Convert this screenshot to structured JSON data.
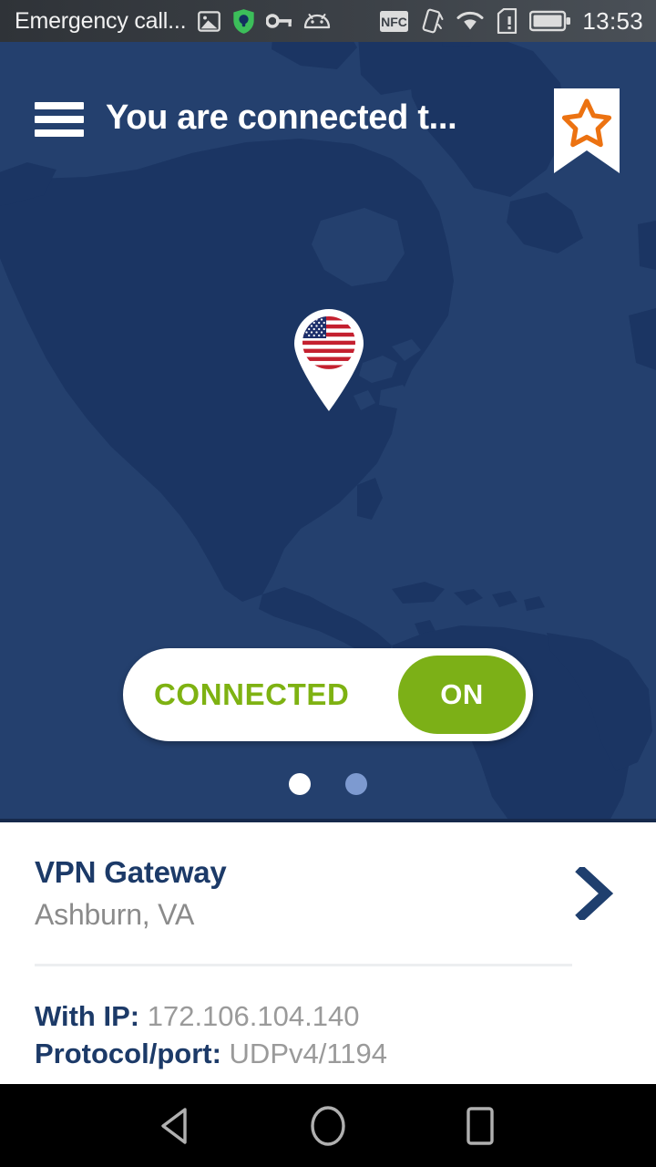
{
  "status_bar": {
    "carrier_text": "Emergency call...",
    "clock": "13:53",
    "left_icons": [
      "screenshot-icon",
      "openvpn-shield-icon",
      "vpn-key-icon",
      "android-robot-icon"
    ],
    "right_icons": [
      "nfc-icon",
      "vibrate-icon",
      "wifi-icon",
      "sim-alert-icon",
      "battery-icon"
    ],
    "background": "#3c4147",
    "text_color": "#f2f2f2"
  },
  "app_bar": {
    "title": "You are connected t...",
    "menu_icon": "hamburger-menu-icon",
    "favorite_icon": "star-ribbon-icon",
    "star_color": "#ec7211",
    "ribbon_color": "#ffffff"
  },
  "map": {
    "ocean_color": "#24406e",
    "land_color": "#1b3563",
    "marker": "us-flag-map-pin",
    "marker_country": "United States"
  },
  "toggle": {
    "label": "CONNECTED",
    "knob_label": "ON",
    "state": "on",
    "green": "#7cb017",
    "track_color": "#ffffff"
  },
  "pager": {
    "total": 2,
    "active_index": 0,
    "active_color": "#ffffff",
    "inactive_color": "#7d9ad0"
  },
  "gateway": {
    "title": "VPN Gateway",
    "location": "Ashburn, VA",
    "chevron_icon": "chevron-right-icon",
    "title_color": "#1c3a68",
    "location_color": "#8b8b8b"
  },
  "details": [
    {
      "key": "With IP:",
      "value": "172.106.104.140"
    },
    {
      "key": "Protocol/port:",
      "value": "UDPv4/1194"
    }
  ],
  "nav_bar": {
    "back": "back-triangle-icon",
    "home": "home-circle-icon",
    "recents": "recents-square-icon",
    "background": "#000000",
    "icon_color": "#b0b0b0"
  }
}
